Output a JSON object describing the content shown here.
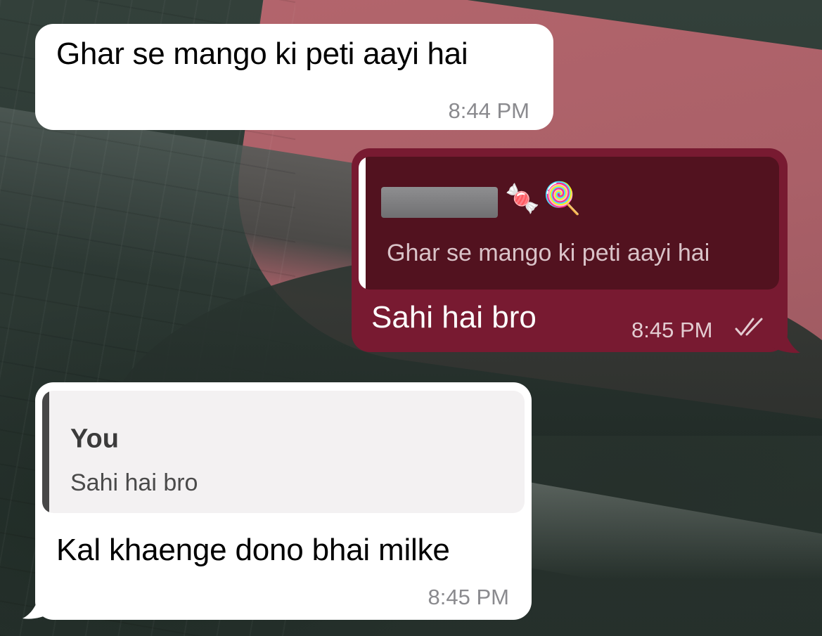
{
  "messages": [
    {
      "direction": "incoming",
      "text": "Ghar se mango ki peti aayi hai",
      "time": "8:44 PM"
    },
    {
      "direction": "outgoing",
      "reply_to": {
        "author_emoji_1": "🍬",
        "author_emoji_2": "🍭",
        "text": "Ghar se mango ki peti aayi hai"
      },
      "text": "Sahi hai bro",
      "time": "8:45 PM",
      "status_icon": "double-check-read-icon"
    },
    {
      "direction": "incoming",
      "reply_to": {
        "author": "You",
        "text": "Sahi hai bro"
      },
      "text": "Kal khaenge dono bhai milke",
      "time": "8:45 PM"
    }
  ],
  "colors": {
    "incoming_bubble": "#ffffff",
    "outgoing_bubble": "#781a31",
    "outgoing_quote": "#52121f",
    "incoming_quote": "#f3f1f2",
    "wallpaper_pink": "#b3656c"
  }
}
